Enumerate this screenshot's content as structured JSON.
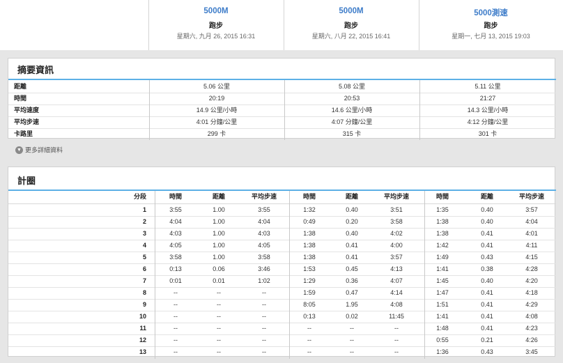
{
  "activities": [
    {
      "title": "5000M",
      "type": "跑步",
      "date": "星期六, 九月 26, 2015 16:31"
    },
    {
      "title": "5000M",
      "type": "跑步",
      "date": "星期六, 八月 22, 2015 16:41"
    },
    {
      "title": "5000測速",
      "type": "跑步",
      "date": "星期一, 七月 13, 2015 19:03"
    }
  ],
  "summary": {
    "title": "摘要資訊",
    "rows": [
      {
        "label": "距離",
        "values": [
          "5.06 公里",
          "5.08 公里",
          "5.11 公里"
        ]
      },
      {
        "label": "時間",
        "values": [
          "20:19",
          "20:53",
          "21:27"
        ]
      },
      {
        "label": "平均速度",
        "values": [
          "14.9 公里/小時",
          "14.6 公里/小時",
          "14.3 公里/小時"
        ]
      },
      {
        "label": "平均步速",
        "values": [
          "4:01 分鐘/公里",
          "4:07 分鐘/公里",
          "4:12 分鐘/公里"
        ]
      },
      {
        "label": "卡路里",
        "values": [
          "299 卡",
          "315 卡",
          "301 卡"
        ]
      }
    ]
  },
  "more_details": "更多詳細資料",
  "laps": {
    "title": "計圈",
    "lap_header": "分段",
    "col_headers": [
      "時間",
      "距離",
      "平均步速"
    ],
    "rows": [
      {
        "lap": "1",
        "vals": [
          "3:55",
          "1.00",
          "3:55",
          "1:32",
          "0.40",
          "3:51",
          "1:35",
          "0.40",
          "3:57"
        ]
      },
      {
        "lap": "2",
        "vals": [
          "4:04",
          "1.00",
          "4:04",
          "0:49",
          "0.20",
          "3:58",
          "1:38",
          "0.40",
          "4:04"
        ]
      },
      {
        "lap": "3",
        "vals": [
          "4:03",
          "1.00",
          "4:03",
          "1:38",
          "0.40",
          "4:02",
          "1:38",
          "0.41",
          "4:01"
        ]
      },
      {
        "lap": "4",
        "vals": [
          "4:05",
          "1.00",
          "4:05",
          "1:38",
          "0.41",
          "4:00",
          "1:42",
          "0.41",
          "4:11"
        ]
      },
      {
        "lap": "5",
        "vals": [
          "3:58",
          "1.00",
          "3:58",
          "1:38",
          "0.41",
          "3:57",
          "1:49",
          "0.43",
          "4:15"
        ]
      },
      {
        "lap": "6",
        "vals": [
          "0:13",
          "0.06",
          "3:46",
          "1:53",
          "0.45",
          "4:13",
          "1:41",
          "0.38",
          "4:28"
        ]
      },
      {
        "lap": "7",
        "vals": [
          "0:01",
          "0.01",
          "1:02",
          "1:29",
          "0.36",
          "4:07",
          "1:45",
          "0.40",
          "4:20"
        ]
      },
      {
        "lap": "8",
        "vals": [
          "--",
          "--",
          "--",
          "1:59",
          "0.47",
          "4:14",
          "1:47",
          "0.41",
          "4:18"
        ]
      },
      {
        "lap": "9",
        "vals": [
          "--",
          "--",
          "--",
          "8:05",
          "1.95",
          "4:08",
          "1:51",
          "0.41",
          "4:29"
        ]
      },
      {
        "lap": "10",
        "vals": [
          "--",
          "--",
          "--",
          "0:13",
          "0.02",
          "11:45",
          "1:41",
          "0.41",
          "4:08"
        ]
      },
      {
        "lap": "11",
        "vals": [
          "--",
          "--",
          "--",
          "--",
          "--",
          "--",
          "1:48",
          "0.41",
          "4:23"
        ]
      },
      {
        "lap": "12",
        "vals": [
          "--",
          "--",
          "--",
          "--",
          "--",
          "--",
          "0:55",
          "0.21",
          "4:26"
        ]
      },
      {
        "lap": "13",
        "vals": [
          "--",
          "--",
          "--",
          "--",
          "--",
          "--",
          "1:36",
          "0.43",
          "3:45"
        ]
      }
    ]
  },
  "colors": {
    "accent": "#3d7cc9",
    "divider": "#5cb0e6",
    "background": "#e6e6e6"
  }
}
